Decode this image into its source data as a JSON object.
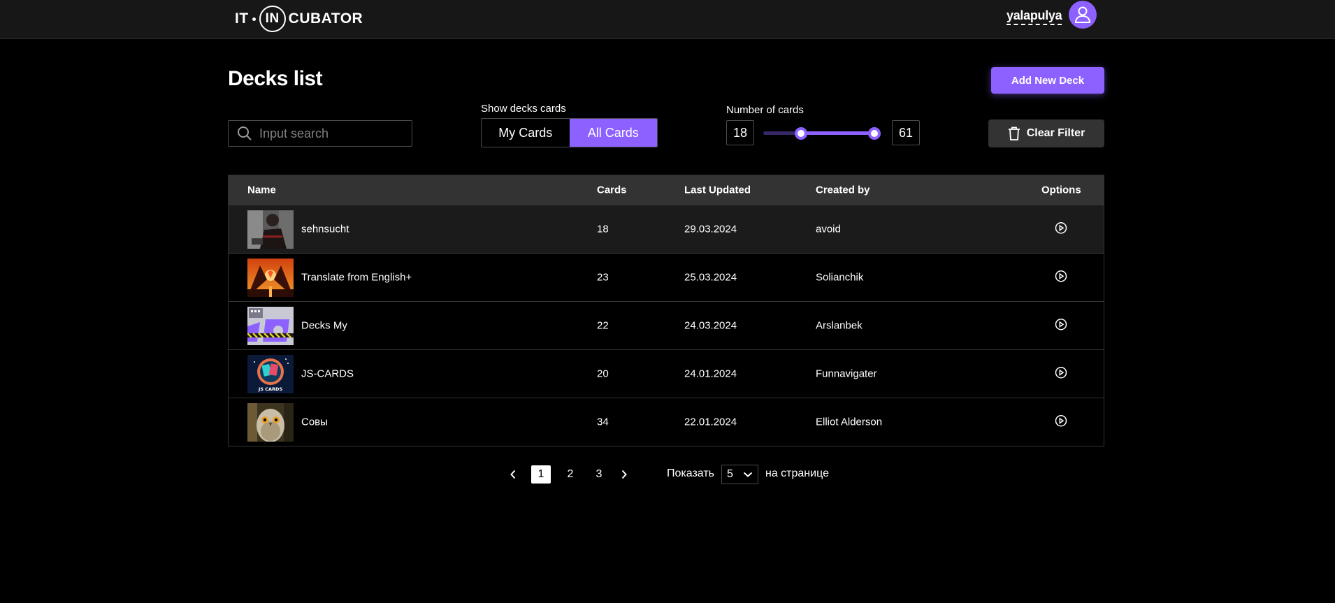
{
  "header": {
    "logo": {
      "left": "IT",
      "middle": "IN",
      "right": "CUBATOR"
    },
    "username": "yalapulya",
    "avatar_icon": "user-icon"
  },
  "page": {
    "title": "Decks list",
    "add_button": "Add New Deck"
  },
  "filters": {
    "search_placeholder": "Input search",
    "show_label": "Show decks cards",
    "toggle_options": [
      "My Cards",
      "All Cards"
    ],
    "toggle_selected": "All Cards",
    "cards_label": "Number of cards",
    "range_min": "18",
    "range_max": "61",
    "clear_button": "Clear Filter"
  },
  "table": {
    "columns": [
      "Name",
      "Cards",
      "Last Updated",
      "Created by",
      "Options"
    ],
    "rows": [
      {
        "name": "sehnsucht",
        "cards": "18",
        "updated": "29.03.2024",
        "author": "avoid"
      },
      {
        "name": "Translate from English+",
        "cards": "23",
        "updated": "25.03.2024",
        "author": "Solianchik"
      },
      {
        "name": "Decks My",
        "cards": "22",
        "updated": "24.03.2024",
        "author": "Arslanbek"
      },
      {
        "name": "JS-CARDS",
        "cards": "20",
        "updated": "24.01.2024",
        "author": "Funnavigater"
      },
      {
        "name": "Совы",
        "cards": "34",
        "updated": "22.01.2024",
        "author": "Elliot Alderson"
      }
    ],
    "thumb_text_js": "JS CARDS"
  },
  "pagination": {
    "pages": [
      "1",
      "2",
      "3"
    ],
    "current": "1",
    "show_label": "Показать",
    "per_page": "5",
    "per_page_label": "на странице"
  },
  "colors": {
    "accent": "#8c61ff",
    "header_bg": "#171717",
    "table_header_bg": "#333333"
  }
}
